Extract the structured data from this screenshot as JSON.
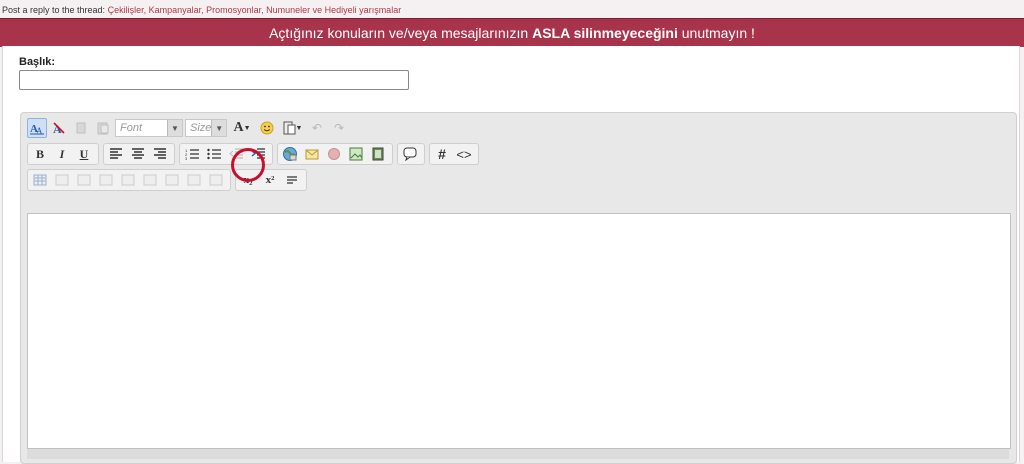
{
  "breadcrumb": {
    "prefix": "Post a reply to the thread:",
    "thread": "Çekilişler, Kampanyalar, Promosyonlar, Numuneler ve Hediyeli yarışmalar"
  },
  "banner": {
    "part1": "Açtığınız konuların ve/veya mesajlarınızın ",
    "bold": "ASLA silinmeyeceğini",
    "part2": " unutmayın !"
  },
  "form": {
    "title_label": "Başlık:",
    "title_value": ""
  },
  "toolbar": {
    "font_placeholder": "Font",
    "size_placeholder": "Size",
    "font_color_glyph": "A",
    "bold": "B",
    "italic": "I",
    "underline": "U",
    "hash": "#",
    "code": "<>",
    "subscript": "x₂",
    "superscript": "x²"
  },
  "colors": {
    "banner": "#a8344c",
    "highlight_ring": "#c8102e",
    "link": "#b03a4a"
  }
}
